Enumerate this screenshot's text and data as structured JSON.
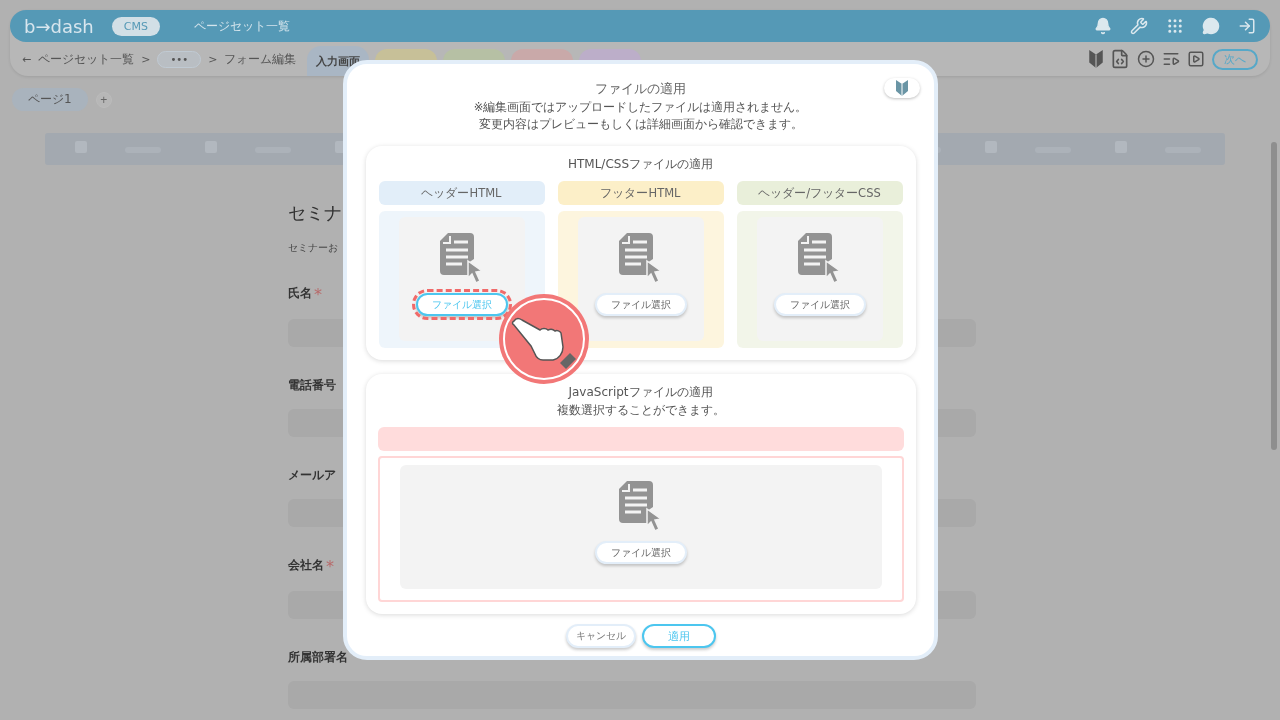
{
  "top_bar": {
    "logo": "b→dash",
    "module": "CMS",
    "title": "ページセット一覧"
  },
  "breadcrumb": {
    "back": "←",
    "items": [
      "ページセット一覧",
      "•••",
      "フォーム編集"
    ],
    "separator": ">"
  },
  "screen_tabs": [
    {
      "label": "入力画面",
      "selected": true,
      "color": "#a9b6c4"
    },
    {
      "selected": false,
      "color": "#c7c098"
    },
    {
      "selected": false,
      "color": "#b6c0a4"
    },
    {
      "selected": false,
      "color": "#c9a9a9"
    },
    {
      "selected": false,
      "color": "#bcaec9"
    }
  ],
  "next_button": "次へ",
  "pages": [
    {
      "label": "ページ1",
      "selected": true
    }
  ],
  "add_page": "+",
  "form": {
    "title": "セミナ",
    "description": "セミナーお",
    "fields": [
      {
        "label": "氏名",
        "required_mark": "*"
      },
      {
        "label": "電話番号"
      },
      {
        "label": "メールア"
      },
      {
        "label": "会社名",
        "required_mark": "*"
      },
      {
        "label": "所属部署名"
      }
    ]
  },
  "dialog": {
    "title": "ファイルの適用",
    "notes": [
      "※編集画面ではアップロードしたファイルは適用されません。",
      "変更内容はプレビューもしくは詳細画面から確認できます。"
    ],
    "html_css": {
      "title": "HTML/CSSファイルの適用",
      "slots": [
        {
          "label": "ヘッダーHTML",
          "color": "#e2eef9",
          "button": "ファイル選択",
          "highlighted": true
        },
        {
          "label": "フッターHTML",
          "color": "#fcefc8",
          "button": "ファイル選択",
          "highlighted": false
        },
        {
          "label": "ヘッダー/フッターCSS",
          "color": "#e9efda",
          "button": "ファイル選択",
          "highlighted": false
        }
      ]
    },
    "javascript": {
      "title": "JavaScriptファイルの適用",
      "note": "複数選択することができます。",
      "button": "ファイル選択"
    },
    "cancel": "キャンセル",
    "apply": "適用"
  }
}
